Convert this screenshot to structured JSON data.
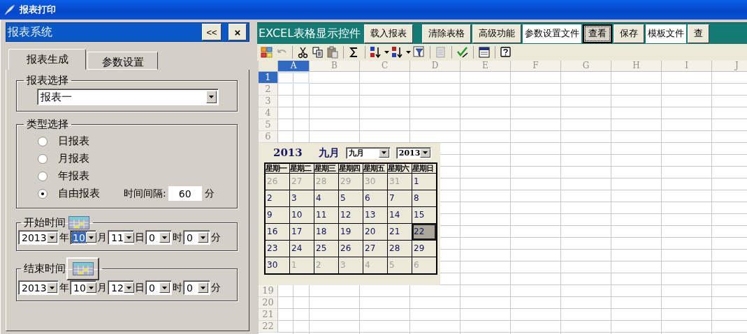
{
  "window": {
    "title": "报表打印"
  },
  "left_panel": {
    "title": "报表系统",
    "buttons": [
      "<<",
      "×"
    ],
    "tabs": [
      {
        "label": "报表生成",
        "selected": true
      },
      {
        "label": "参数设置",
        "selected": false
      }
    ],
    "report_select": {
      "legend": "报表选择",
      "value": "报表一"
    },
    "type_select": {
      "legend": "类型选择",
      "options": [
        {
          "label": "日报表",
          "selected": false
        },
        {
          "label": "月报表",
          "selected": false
        },
        {
          "label": "年报表",
          "selected": false
        },
        {
          "label": "自由报表",
          "selected": true
        }
      ],
      "interval_label": "时间间隔:",
      "interval_value": "60",
      "interval_unit": "分"
    },
    "times": [
      {
        "legend": "开始时间",
        "raised": false,
        "parts": [
          {
            "value": "2013",
            "unit": "年",
            "highlighted": false
          },
          {
            "value": "10",
            "unit": "月",
            "highlighted": true
          },
          {
            "value": "11",
            "unit": "日",
            "highlighted": false
          },
          {
            "value": "0",
            "unit": "时",
            "highlighted": false
          },
          {
            "value": "0",
            "unit": "分",
            "highlighted": false
          }
        ]
      },
      {
        "legend": "结束时间",
        "raised": true,
        "parts": [
          {
            "value": "2013",
            "unit": "年",
            "highlighted": false
          },
          {
            "value": "10",
            "unit": "月",
            "highlighted": false
          },
          {
            "value": "12",
            "unit": "日",
            "highlighted": false
          },
          {
            "value": "0",
            "unit": "时",
            "highlighted": false
          },
          {
            "value": "0",
            "unit": "分",
            "highlighted": false
          }
        ]
      }
    ]
  },
  "toolbar": {
    "title": "EXCEL表格显示控件",
    "items": [
      {
        "kind": "button",
        "label": "载入报表",
        "focused": false
      },
      {
        "kind": "button",
        "label": "清除表格",
        "focused": false
      },
      {
        "kind": "button",
        "label": "高级功能",
        "focused": false
      },
      {
        "kind": "label",
        "label": "参数设置文件"
      },
      {
        "kind": "button",
        "label": "查看",
        "focused": true
      },
      {
        "kind": "button",
        "label": "保存",
        "focused": false
      },
      {
        "kind": "label",
        "label": "模板文件"
      },
      {
        "kind": "button",
        "label": "查",
        "focused": false
      }
    ]
  },
  "sheet": {
    "columns": [
      {
        "label": "A",
        "selected": true
      },
      {
        "label": "B",
        "selected": false
      },
      {
        "label": "C",
        "selected": false
      },
      {
        "label": "D",
        "selected": false
      },
      {
        "label": "E",
        "selected": false
      },
      {
        "label": "F",
        "selected": false
      },
      {
        "label": "G",
        "selected": false
      },
      {
        "label": "H",
        "selected": false
      },
      {
        "label": "I",
        "selected": false
      },
      {
        "label": "J",
        "selected": false
      }
    ],
    "rows_top": [
      {
        "label": "1",
        "selected": true
      },
      {
        "label": "2",
        "selected": false
      },
      {
        "label": "3",
        "selected": false
      },
      {
        "label": "4",
        "selected": false
      },
      {
        "label": "5",
        "selected": false
      },
      {
        "label": "6",
        "selected": false
      }
    ],
    "rows_bottom": [
      {
        "label": "19",
        "selected": false
      },
      {
        "label": "20",
        "selected": false
      },
      {
        "label": "21",
        "selected": false
      },
      {
        "label": "22",
        "selected": false
      }
    ]
  },
  "calendar": {
    "year": "2013",
    "month": "九月",
    "month_select": "九月",
    "year_select": "2013",
    "weekdays": [
      "星期一",
      "星期二",
      "星期三",
      "星期四",
      "星期五",
      "星期六",
      "星期日"
    ],
    "weeks": [
      [
        {
          "day": "26",
          "other_month": true,
          "selected": false
        },
        {
          "day": "27",
          "other_month": true,
          "selected": false
        },
        {
          "day": "28",
          "other_month": true,
          "selected": false
        },
        {
          "day": "29",
          "other_month": true,
          "selected": false
        },
        {
          "day": "30",
          "other_month": true,
          "selected": false
        },
        {
          "day": "31",
          "other_month": true,
          "selected": false
        },
        {
          "day": "1",
          "other_month": false,
          "selected": false
        }
      ],
      [
        {
          "day": "2",
          "other_month": false,
          "selected": false
        },
        {
          "day": "3",
          "other_month": false,
          "selected": false
        },
        {
          "day": "4",
          "other_month": false,
          "selected": false
        },
        {
          "day": "5",
          "other_month": false,
          "selected": false
        },
        {
          "day": "6",
          "other_month": false,
          "selected": false
        },
        {
          "day": "7",
          "other_month": false,
          "selected": false
        },
        {
          "day": "8",
          "other_month": false,
          "selected": false
        }
      ],
      [
        {
          "day": "9",
          "other_month": false,
          "selected": false
        },
        {
          "day": "10",
          "other_month": false,
          "selected": false
        },
        {
          "day": "11",
          "other_month": false,
          "selected": false
        },
        {
          "day": "12",
          "other_month": false,
          "selected": false
        },
        {
          "day": "13",
          "other_month": false,
          "selected": false
        },
        {
          "day": "14",
          "other_month": false,
          "selected": false
        },
        {
          "day": "15",
          "other_month": false,
          "selected": false
        }
      ],
      [
        {
          "day": "16",
          "other_month": false,
          "selected": false
        },
        {
          "day": "17",
          "other_month": false,
          "selected": false
        },
        {
          "day": "18",
          "other_month": false,
          "selected": false
        },
        {
          "day": "19",
          "other_month": false,
          "selected": false
        },
        {
          "day": "20",
          "other_month": false,
          "selected": false
        },
        {
          "day": "21",
          "other_month": false,
          "selected": false
        },
        {
          "day": "22",
          "other_month": false,
          "selected": true
        }
      ],
      [
        {
          "day": "23",
          "other_month": false,
          "selected": false
        },
        {
          "day": "24",
          "other_month": false,
          "selected": false
        },
        {
          "day": "25",
          "other_month": false,
          "selected": false
        },
        {
          "day": "26",
          "other_month": false,
          "selected": false
        },
        {
          "day": "27",
          "other_month": false,
          "selected": false
        },
        {
          "day": "28",
          "other_month": false,
          "selected": false
        },
        {
          "day": "29",
          "other_month": false,
          "selected": false
        }
      ],
      [
        {
          "day": "30",
          "other_month": false,
          "selected": false
        },
        {
          "day": "1",
          "other_month": true,
          "selected": false
        },
        {
          "day": "2",
          "other_month": true,
          "selected": false
        },
        {
          "day": "3",
          "other_month": true,
          "selected": false
        },
        {
          "day": "4",
          "other_month": true,
          "selected": false
        },
        {
          "day": "5",
          "other_month": true,
          "selected": false
        },
        {
          "day": "6",
          "other_month": true,
          "selected": false
        }
      ]
    ]
  }
}
